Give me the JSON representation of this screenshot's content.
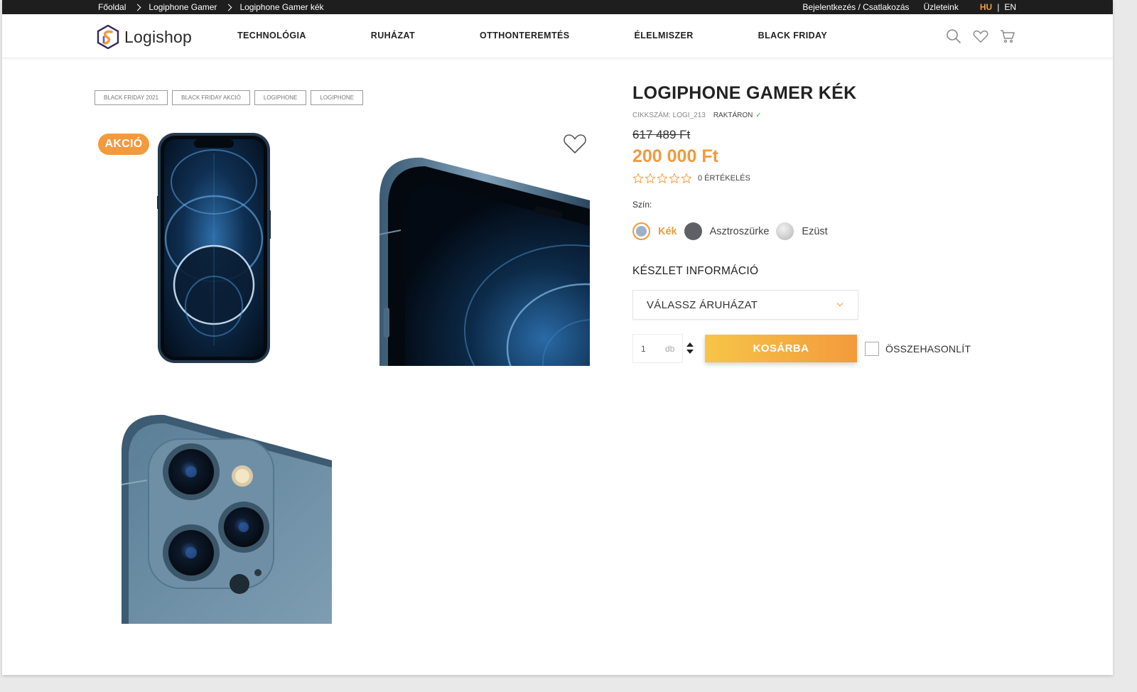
{
  "breadcrumb": [
    "Főoldal",
    "Logiphone Gamer",
    "Logiphone Gamer kék"
  ],
  "topbar": {
    "login": "Bejelentkezés / Csatlakozás",
    "stores": "Üzleteink",
    "lang_hu": "HU",
    "lang_sep": "|",
    "lang_en": "EN"
  },
  "brand": {
    "name": "Logishop"
  },
  "nav": [
    "TECHNOLÓGIA",
    "RUHÁZAT",
    "OTTHONTEREMTÉS",
    "ÉLELMISZER",
    "BLACK FRIDAY"
  ],
  "header_icons": [
    "search-icon",
    "heart-icon",
    "cart-icon"
  ],
  "tags": [
    "BLACK FRIDAY 2021",
    "BLACK FRIDAY AKCIÓ",
    "LOGIPHONE",
    "LOGIPHONE"
  ],
  "badge": "AKCIÓ",
  "product": {
    "title": "LOGIPHONE GAMER KÉK",
    "sku": "CIKKSZÁM: LOGI_213",
    "stock": "RAKTÁRON",
    "old_price": "617 489 Ft",
    "new_price": "200 000 Ft",
    "rating": 0,
    "max_rating": 5,
    "rating_count": "0 ÉRTÉKELÉS",
    "color_label": "Szín:",
    "colors": [
      {
        "name": "Kék",
        "hex": "#9db1c8",
        "selected": true
      },
      {
        "name": "Asztroszürke",
        "hex": "#5f6066",
        "selected": false
      },
      {
        "name": "Ezüst",
        "hex": "#c8c8c8",
        "selected": false
      }
    ],
    "stock_info_title": "KÉSZLET INFORMÁCIÓ",
    "store_select": "VÁLASSZ ÁRUHÁZAT",
    "qty": "1",
    "qty_unit": "db",
    "cart_button": "KOSÁRBA",
    "compare": "ÖSSZEHASONLÍT"
  },
  "colors": {
    "accent": "#f39a3c",
    "topbar": "#1e1e1e",
    "stock_check": "#3bb36b"
  }
}
